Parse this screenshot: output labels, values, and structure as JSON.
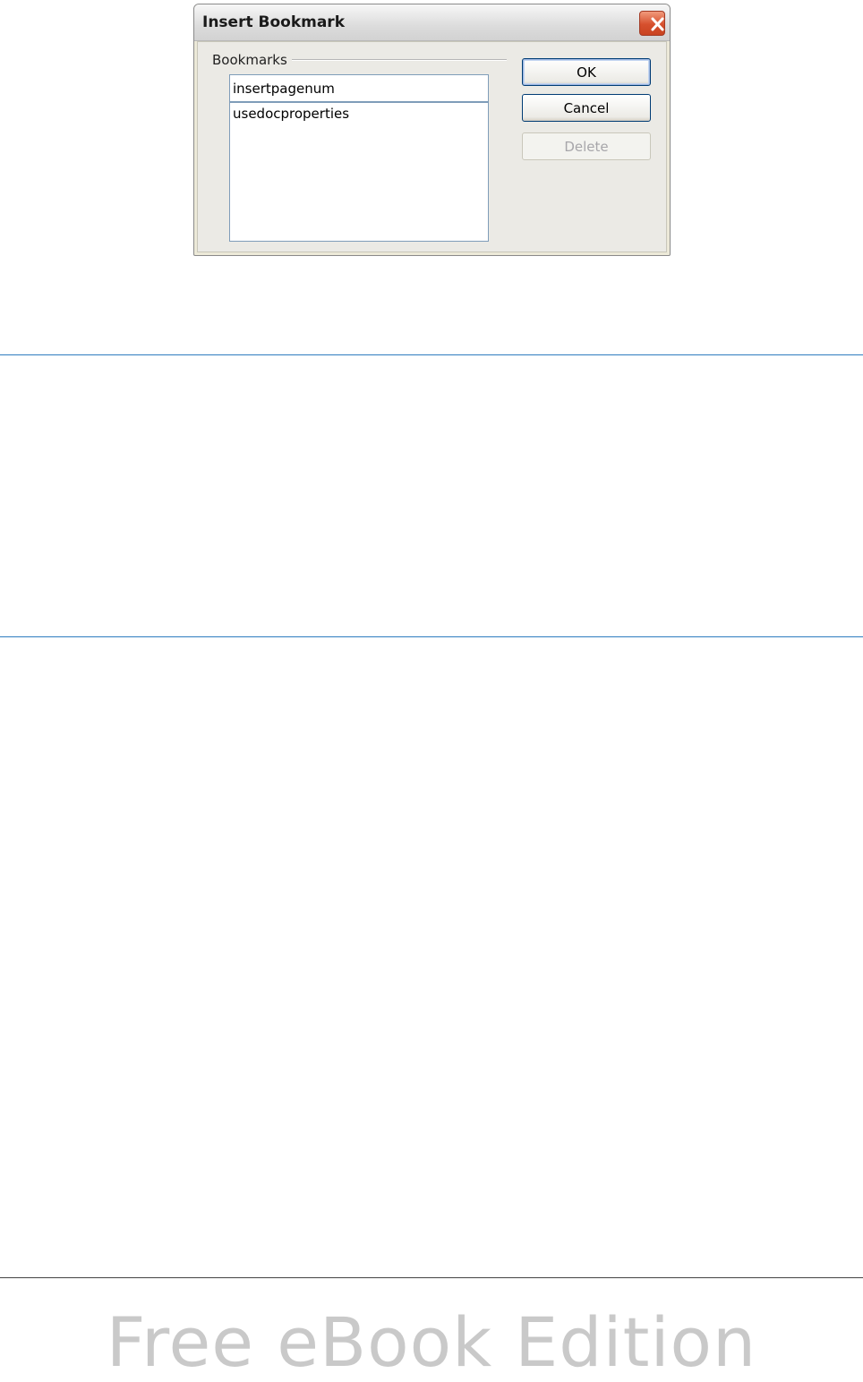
{
  "dialog": {
    "title": "Insert Bookmark",
    "group_label": "Bookmarks",
    "name_field_value": "insertpagenum",
    "bookmarks": [
      "usedocproperties"
    ],
    "buttons": {
      "ok": "OK",
      "cancel": "Cancel",
      "delete": "Delete"
    },
    "close_icon": "close-icon",
    "colors": {
      "close_button": "#d6502e",
      "field_border": "#7f9db9",
      "button_border": "#003c74"
    }
  },
  "footer": {
    "watermark": "Free eBook Edition"
  },
  "colors": {
    "section_rule": "#2e7cbf",
    "watermark": "#c9c9c9"
  }
}
